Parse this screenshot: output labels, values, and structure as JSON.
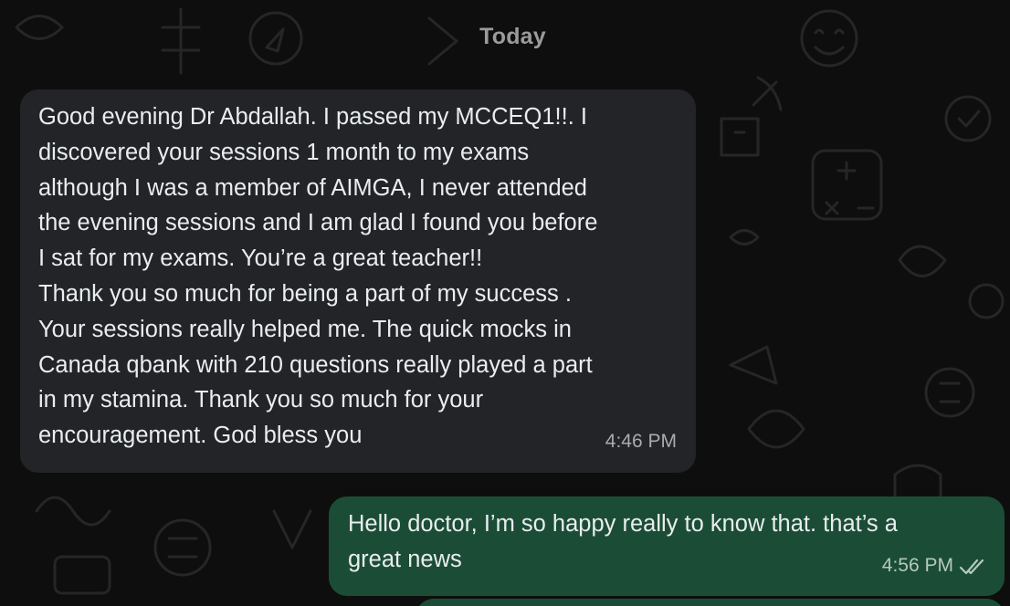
{
  "date_separator": "Today",
  "messages": [
    {
      "direction": "incoming",
      "text": "Good evening Dr Abdallah. I passed my MCCEQ1!!. I\ndiscovered your sessions 1 month to my exams\nalthough I was a member of AIMGA, I never attended\nthe evening sessions and I am glad I found you before\nI sat for my exams. You’re a great teacher!!\nThank you so much for being a part of my success .\nYour sessions really helped me. The quick mocks in\nCanada qbank with 210 questions really played a part\nin my stamina. Thank you so much for your\nencouragement. God bless you",
      "time": "4:46 PM"
    },
    {
      "direction": "outgoing",
      "text": "Hello doctor, I’m so happy really to know that. that’s a\ngreat news",
      "time": "4:56 PM",
      "status_icon": "double-check-read-icon"
    }
  ],
  "colors": {
    "background": "#0e0e0e",
    "incoming_bubble": "#222427",
    "outgoing_bubble": "#1b4d36",
    "text": "#e9edef",
    "timestamp": "#a9acae"
  }
}
